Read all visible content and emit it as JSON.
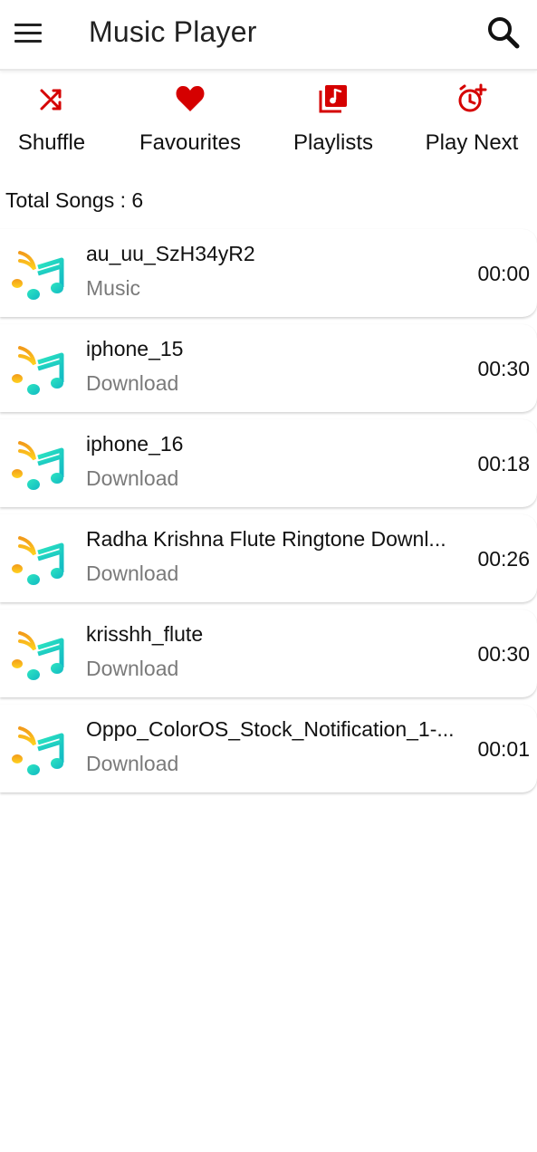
{
  "app": {
    "title": "Music Player"
  },
  "actions": {
    "shuffle": "Shuffle",
    "favourites": "Favourites",
    "playlists": "Playlists",
    "play_next": "Play Next"
  },
  "icons": {
    "menu": "menu-icon",
    "search": "search-icon",
    "shuffle": "shuffle-icon",
    "favourites": "heart-icon",
    "playlists": "playlist-icon",
    "play_next": "alarm-add-icon",
    "song": "music-note-icon"
  },
  "colors": {
    "accent": "#d50000",
    "note_orange": "#f7a21b",
    "note_teal": "#1ecdbf"
  },
  "total_songs_label": "Total Songs : 6",
  "songs": [
    {
      "title": "au_uu_SzH34yR2",
      "folder": "Music",
      "duration": "00:00"
    },
    {
      "title": "iphone_15",
      "folder": "Download",
      "duration": "00:30"
    },
    {
      "title": "iphone_16",
      "folder": "Download",
      "duration": "00:18"
    },
    {
      "title": "Radha Krishna Flute Ringtone Downl...",
      "folder": "Download",
      "duration": "00:26"
    },
    {
      "title": "krisshh_flute",
      "folder": "Download",
      "duration": "00:30"
    },
    {
      "title": "Oppo_ColorOS_Stock_Notification_1-...",
      "folder": "Download",
      "duration": "00:01"
    }
  ]
}
